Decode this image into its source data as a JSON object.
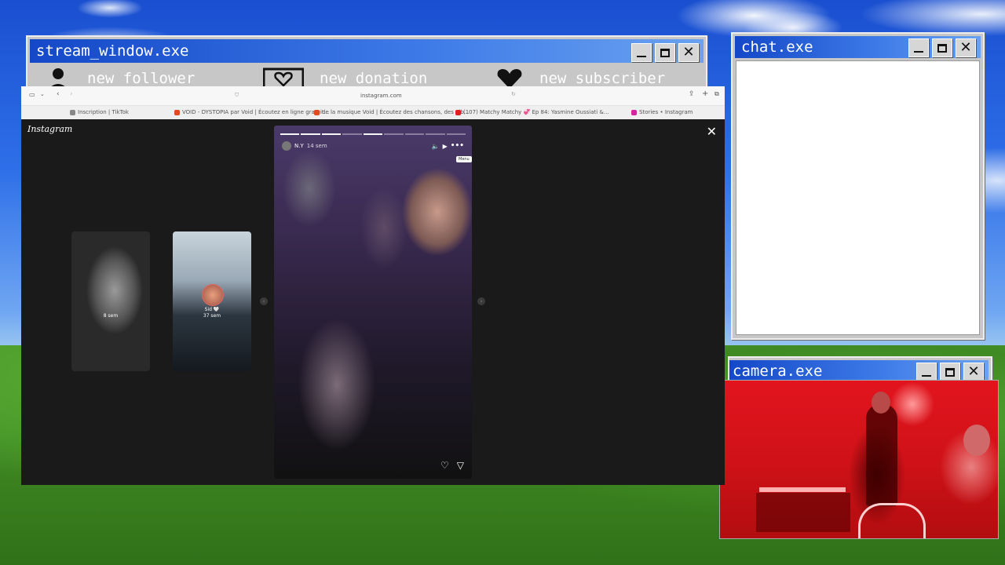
{
  "stream_window": {
    "title": "stream_window.exe"
  },
  "alerts": {
    "follower": "new follower",
    "donation": "new donation",
    "subscriber": "new subscriber"
  },
  "chat_window": {
    "title": "chat.exe"
  },
  "camera_window": {
    "title": "camera.exe"
  },
  "browser": {
    "url": "instagram.com",
    "tabs": [
      {
        "label": "Inscription | TikTok",
        "color": "#888888"
      },
      {
        "label": "VOID - DYSTOPIA par Void | Écoutez en ligne gratuit...",
        "color": "#e14a1f"
      },
      {
        "label": "de la musique Void | Écoutez des chansons, des alb...",
        "color": "#e14a1f"
      },
      {
        "label": "(107) Matchy Matchy 💞 Ep 84: Yasmine Oussiati &...",
        "color": "#e02020"
      },
      {
        "label": "Stories • Instagram",
        "color": "#d6249f"
      }
    ]
  },
  "instagram": {
    "logo": "Instagram",
    "story": {
      "username": "N.Y",
      "time": "14 sem",
      "tooltip": "Menu"
    },
    "side_stories": [
      {
        "time": "8 sem"
      },
      {
        "name": "Sid 🤍",
        "time": "37 sem"
      }
    ]
  }
}
